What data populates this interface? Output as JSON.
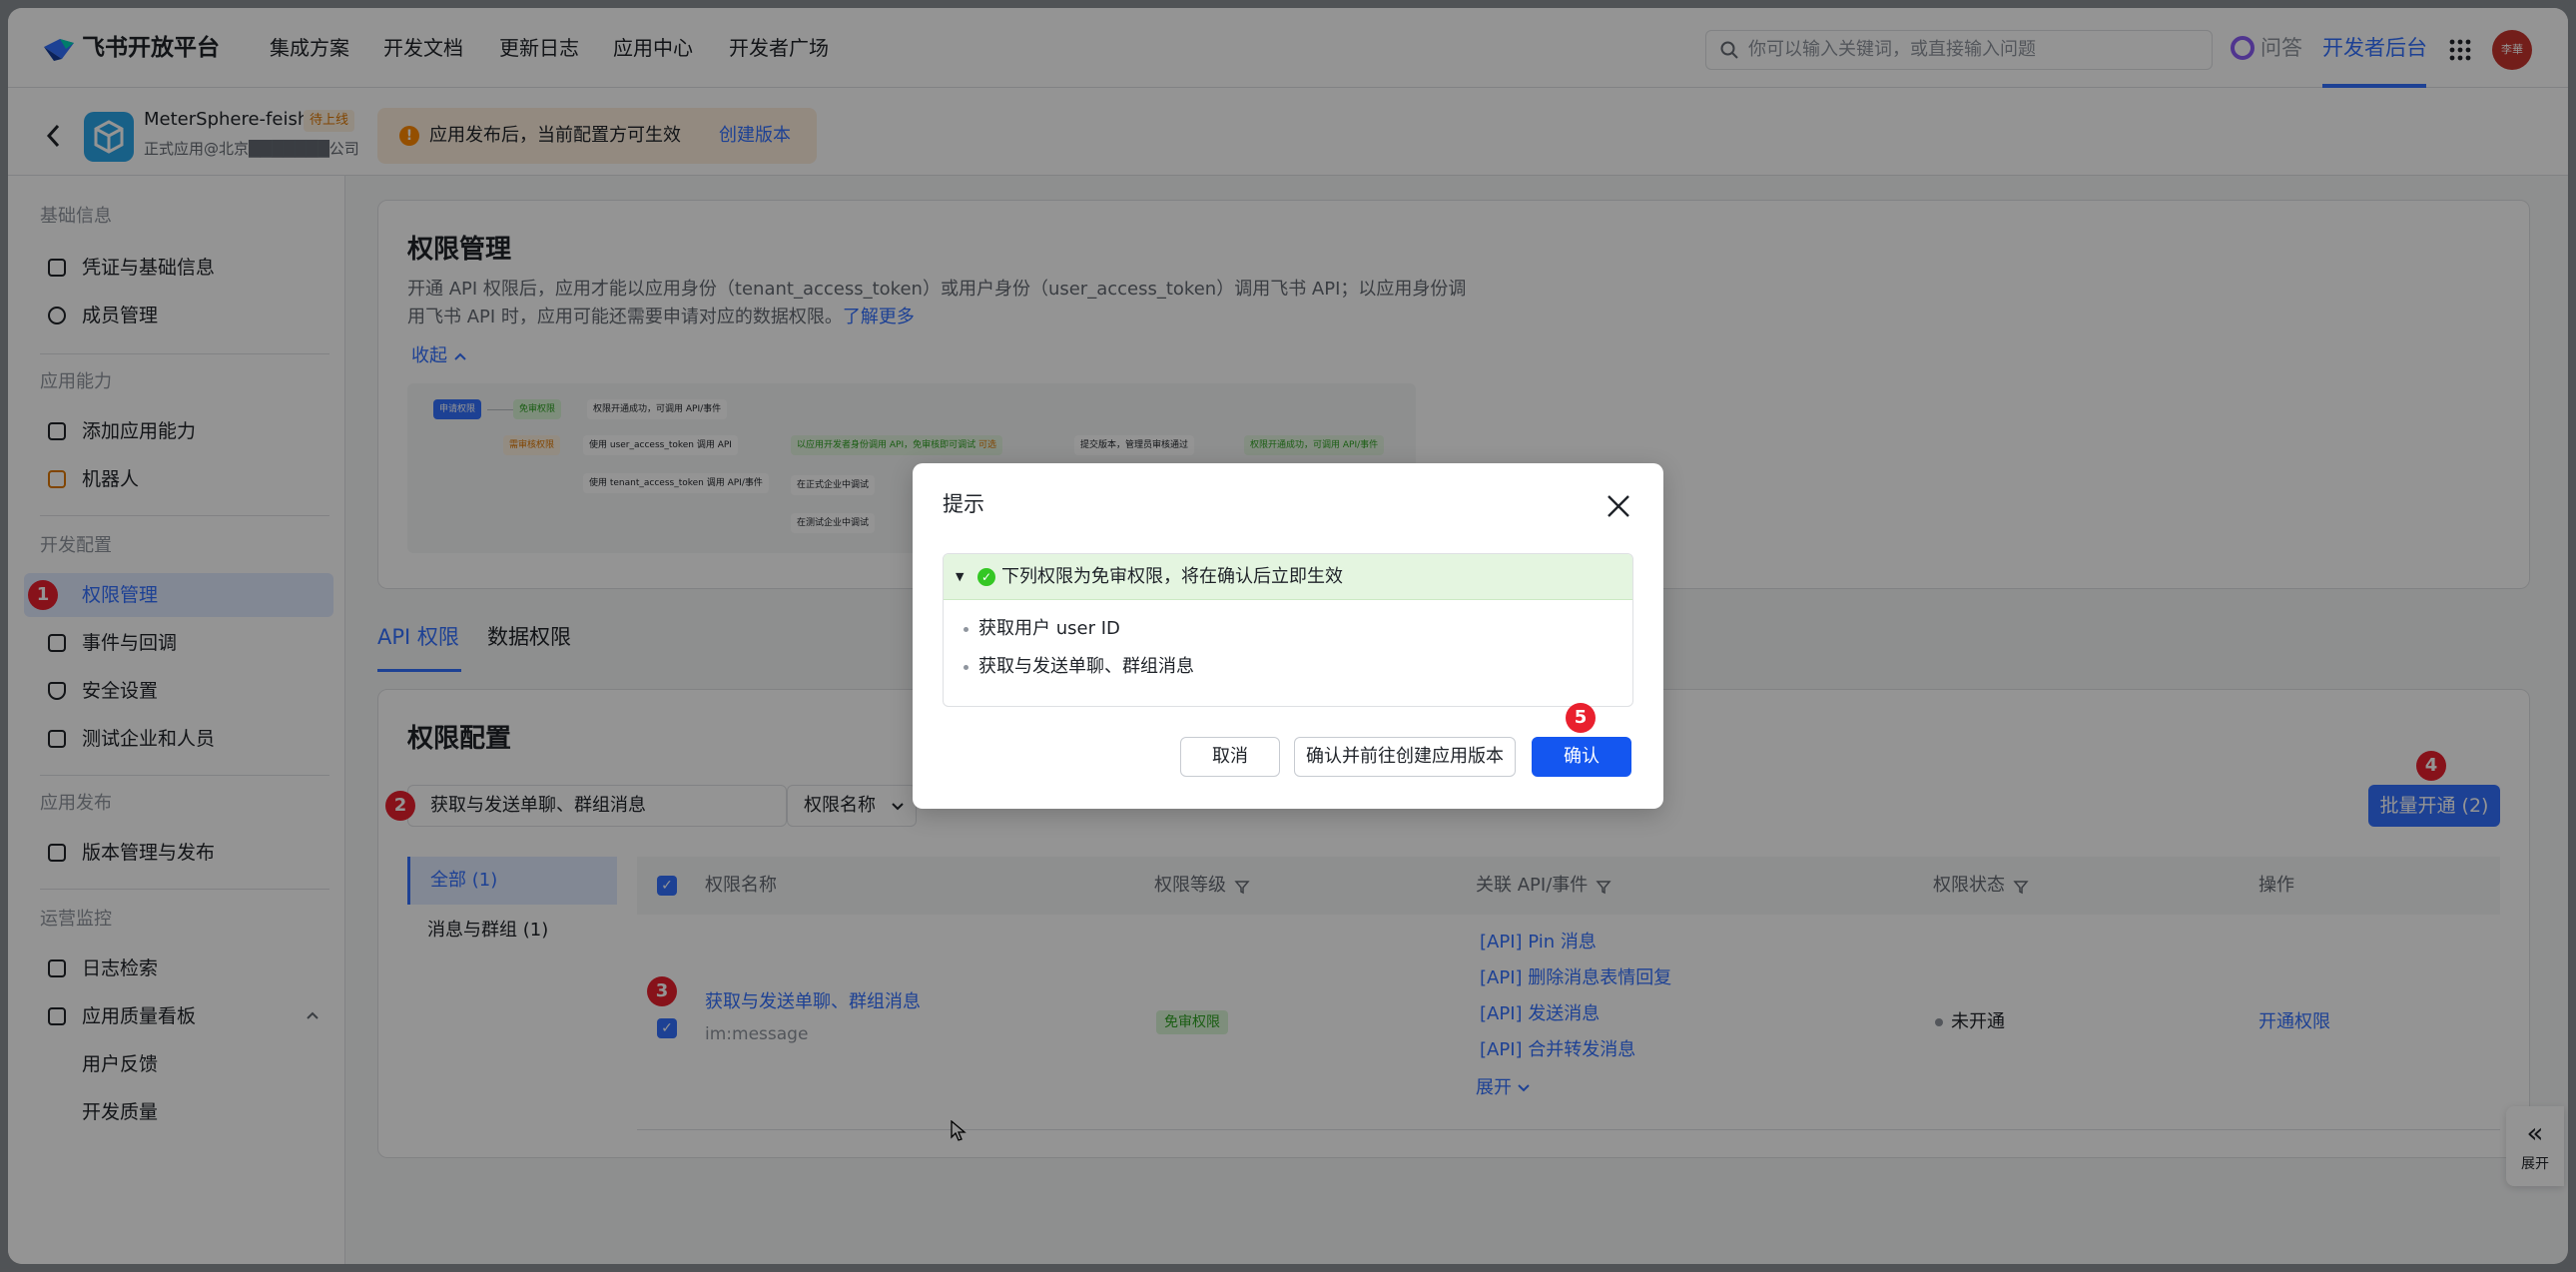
{
  "nav": {
    "brand": "飞书开放平台",
    "links": [
      "集成方案",
      "开发文档",
      "更新日志",
      "应用中心",
      "开发者广场"
    ],
    "search_placeholder": "你可以输入关键词，或直接输入问题",
    "qa": "问答",
    "dev_backend": "开发者后台",
    "avatar": "李華"
  },
  "app": {
    "name": "MeterSphere-feishu",
    "tag": "待上线",
    "sub": "正式应用@北京███████公司",
    "notice": "应用发布后，当前配置方可生效",
    "notice_link": "创建版本"
  },
  "sidebar": {
    "sections": [
      {
        "title": "基础信息",
        "items": [
          "凭证与基础信息",
          "成员管理"
        ]
      },
      {
        "title": "应用能力",
        "items": [
          "添加应用能力",
          "机器人"
        ]
      },
      {
        "title": "开发配置",
        "items": [
          "权限管理",
          "事件与回调",
          "安全设置",
          "测试企业和人员"
        ]
      },
      {
        "title": "应用发布",
        "items": [
          "版本管理与发布"
        ]
      },
      {
        "title": "运营监控",
        "items": [
          "日志检索",
          "应用质量看板",
          "用户反馈",
          "开发质量"
        ]
      }
    ]
  },
  "perm": {
    "title": "权限管理",
    "desc1": "开通 API 权限后，应用才能以应用身份（tenant_access_token）或用户身份（user_access_token）调用飞书 API；以应用身份调",
    "desc2": "用飞书 API 时，应用可能还需要申请对应的数据权限。",
    "learn_more": "了解更多",
    "collapse": "收起",
    "flow": {
      "apply": "申请权限",
      "free": "免审权限",
      "free_result": "权限开通成功，可调用 API/事件",
      "review": "需审核权限",
      "user_token": "使用 user_access_token 调用 API",
      "tenant_token": "使用 tenant_access_token 调用 API/事件",
      "step_dev": "以应用开发者身份调用 API，免审核即可调试",
      "step_dev_tag": "可选",
      "step_submit": "提交版本，管理员审核通过",
      "step_done": "权限开通成功，可调用 API/事件",
      "step_prod": "在正式企业中调试",
      "step_test": "在测试企业中调试"
    }
  },
  "tabs": [
    "API 权限",
    "数据权限"
  ],
  "config": {
    "title": "权限配置",
    "filter_value": "获取与发送单聊、群组消息",
    "filter_select": "权限名称",
    "batch_button": "批量开通 (2)",
    "categories": [
      "全部 (1)",
      "消息与群组 (1)"
    ],
    "columns": [
      "权限名称",
      "权限等级",
      "关联 API/事件",
      "权限状态",
      "操作"
    ],
    "row": {
      "name": "获取与发送单聊、群组消息",
      "code": "im:message",
      "level": "免审权限",
      "apis": [
        "[API] Pin 消息",
        "[API] 删除消息表情回复",
        "[API] 发送消息",
        "[API] 合并转发消息"
      ],
      "more": "展开",
      "status": "未开通",
      "action": "开通权限"
    }
  },
  "expand_tab": "展开",
  "badges": [
    "1",
    "2",
    "3",
    "4",
    "5"
  ],
  "dialog": {
    "title": "提示",
    "alert": "下列权限为免审权限，将在确认后立即生效",
    "items": [
      "获取用户 user ID",
      "获取与发送单聊、群组消息"
    ],
    "cancel": "取消",
    "confirm_create": "确认并前往创建应用版本",
    "confirm": "确认"
  }
}
